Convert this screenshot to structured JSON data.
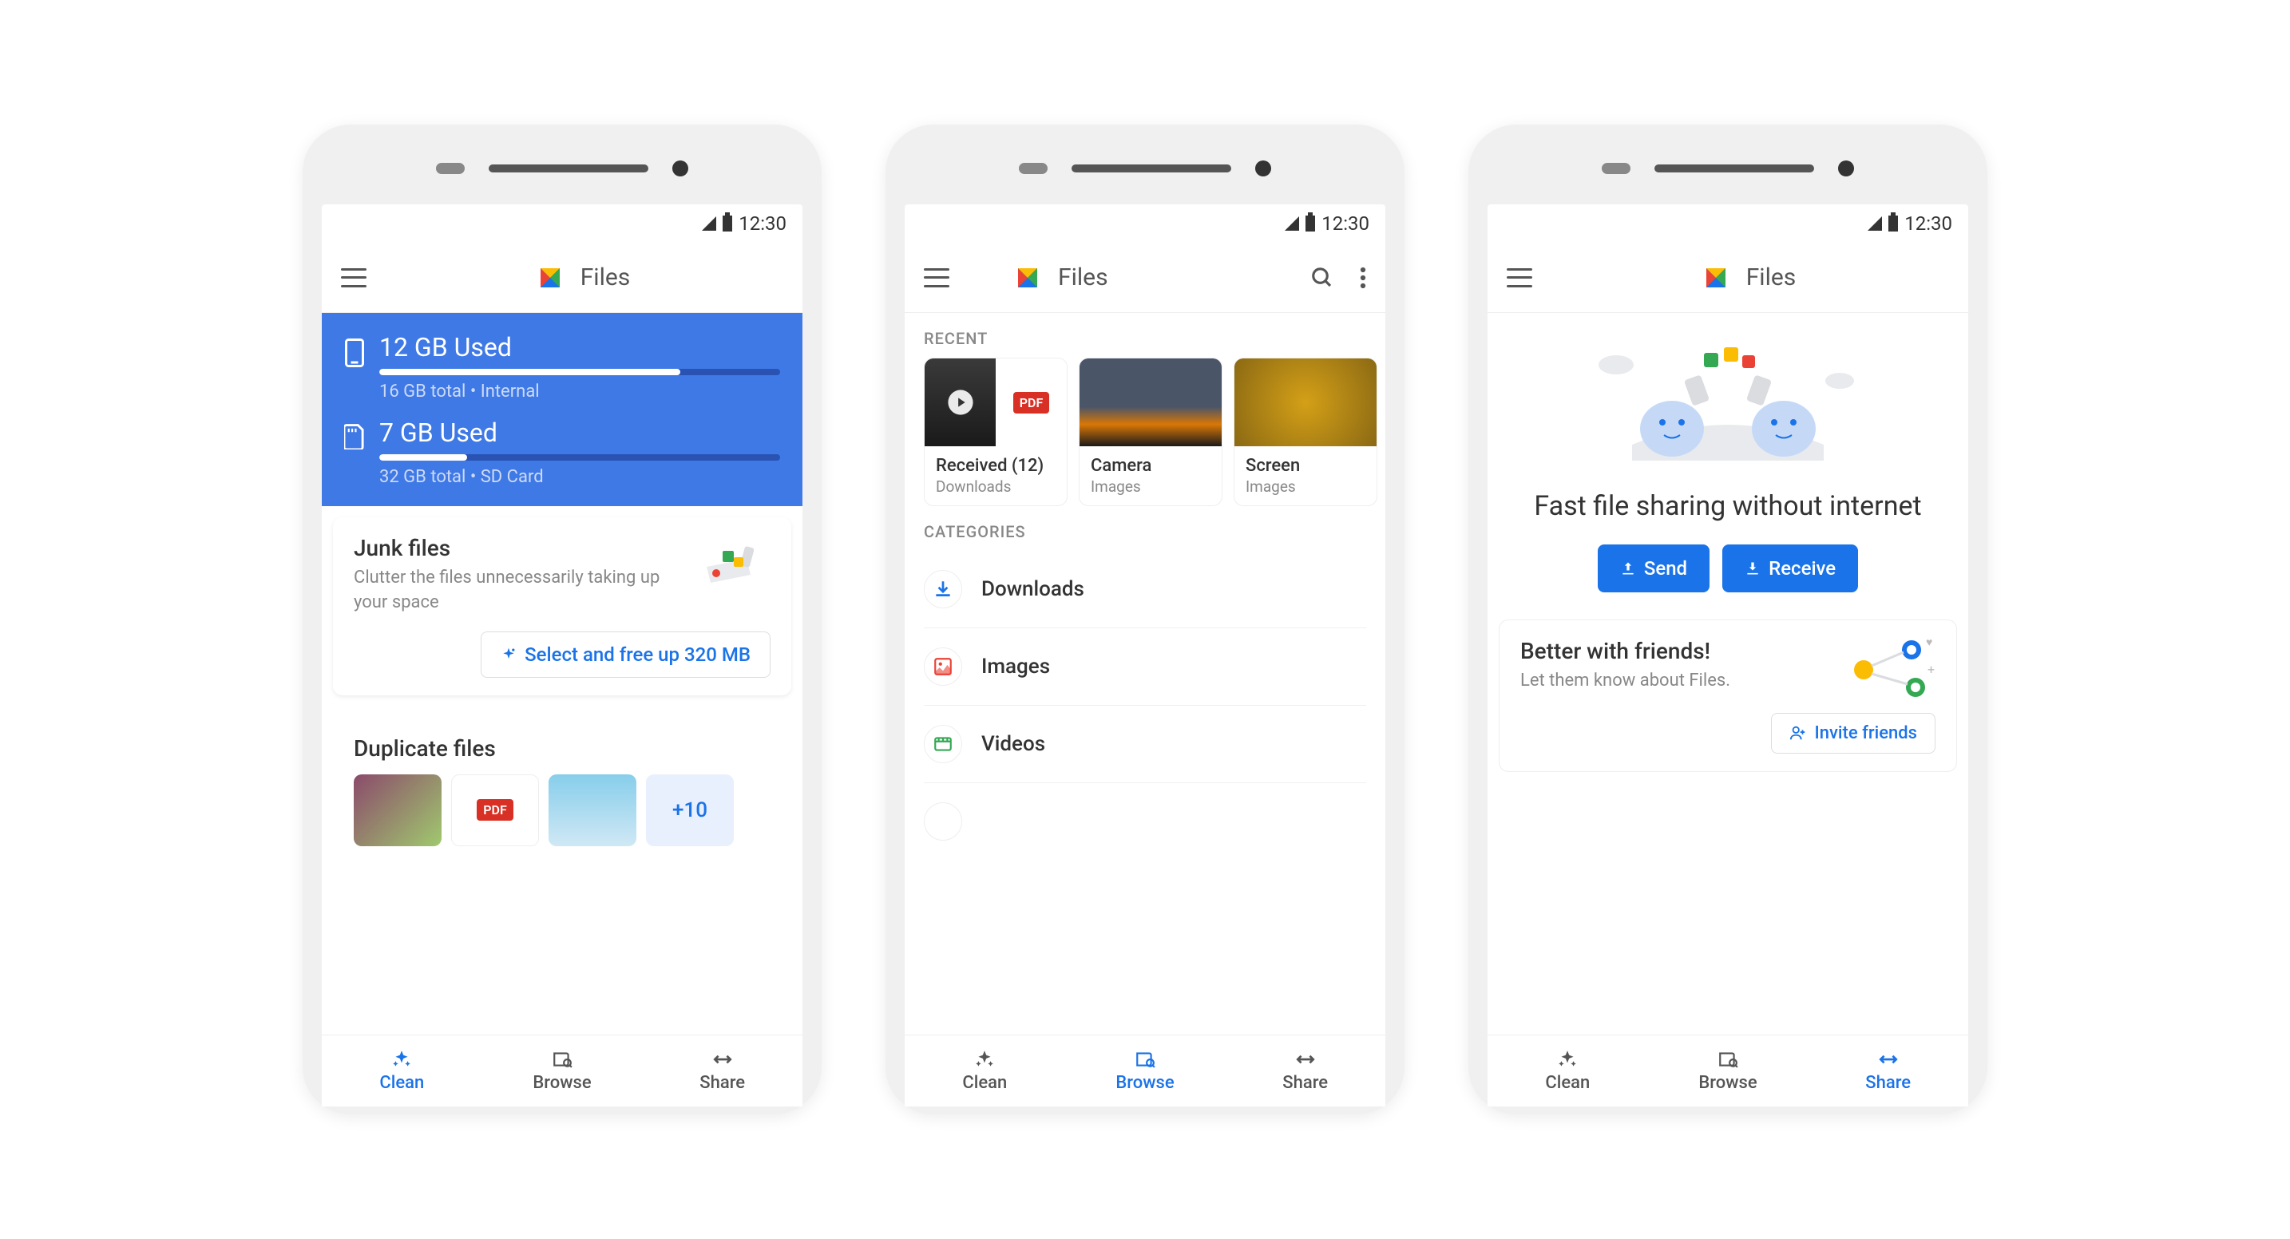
{
  "status_bar": {
    "time": "12:30"
  },
  "app_bar": {
    "title": "Files"
  },
  "clean": {
    "storage": [
      {
        "used": "12 GB Used",
        "detail": "16 GB total • Internal",
        "percent": 75
      },
      {
        "used": "7 GB Used",
        "detail": "32 GB total • SD Card",
        "percent": 22
      }
    ],
    "junk": {
      "title": "Junk files",
      "subtitle": "Clutter the files unnecessarily taking up your space",
      "button": "Select and free up 320 MB"
    },
    "duplicates": {
      "title": "Duplicate files",
      "more": "+10"
    }
  },
  "browse": {
    "recent_label": "RECENT",
    "recent": [
      {
        "title": "Received (12)",
        "sub": "Downloads"
      },
      {
        "title": "Camera",
        "sub": "Images"
      },
      {
        "title": "Screen",
        "sub": "Images"
      }
    ],
    "categories_label": "CATEGORIES",
    "categories": [
      {
        "label": "Downloads",
        "icon": "download"
      },
      {
        "label": "Images",
        "icon": "image"
      },
      {
        "label": "Videos",
        "icon": "video"
      }
    ]
  },
  "share": {
    "title": "Fast file sharing without internet",
    "send": "Send",
    "receive": "Receive",
    "invite": {
      "title": "Better with friends!",
      "subtitle": "Let them know about Files.",
      "button": "Invite friends"
    }
  },
  "nav": [
    {
      "label": "Clean",
      "icon": "clean"
    },
    {
      "label": "Browse",
      "icon": "browse"
    },
    {
      "label": "Share",
      "icon": "share"
    }
  ]
}
